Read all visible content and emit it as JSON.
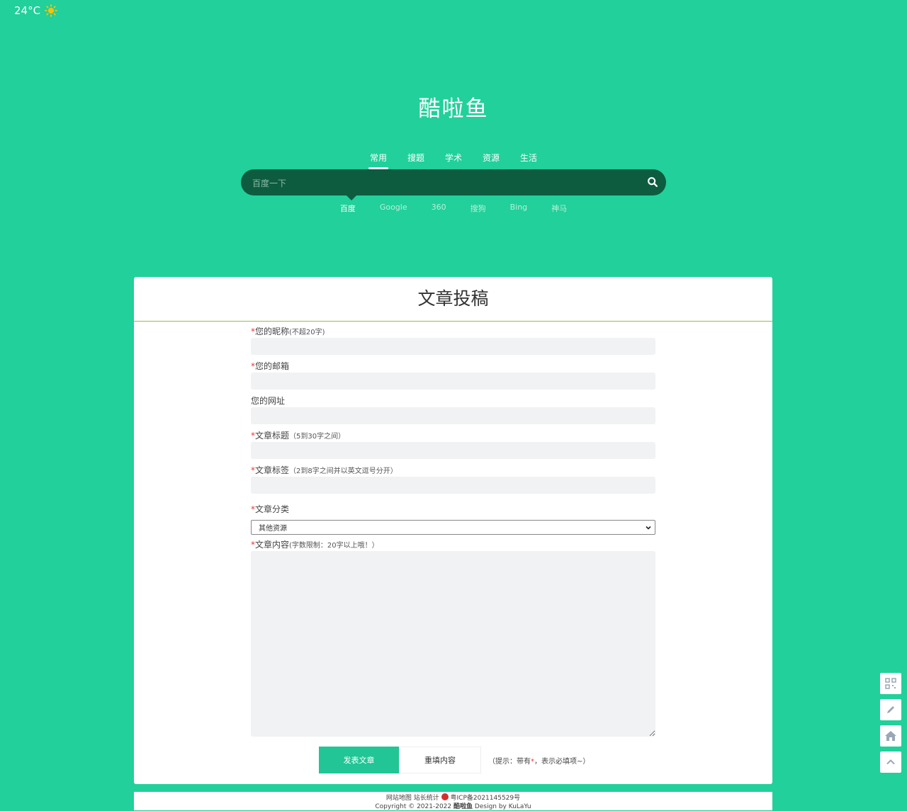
{
  "weather": {
    "temp": "24°C",
    "icon": "sun-icon"
  },
  "site": {
    "title": "酷啦鱼"
  },
  "tabs": [
    "常用",
    "搜题",
    "学术",
    "资源",
    "生活"
  ],
  "active_tab": "常用",
  "search": {
    "placeholder": "百度一下"
  },
  "engines": [
    "百度",
    "Google",
    "360",
    "搜狗",
    "Bing",
    "神马"
  ],
  "active_engine": "百度",
  "form": {
    "title": "文章投稿",
    "fields": {
      "nickname": {
        "label": "您的昵称",
        "hint": "(不超20字)",
        "required": true
      },
      "email": {
        "label": "您的邮箱",
        "hint": "",
        "required": true
      },
      "website": {
        "label": "您的网址",
        "hint": "",
        "required": false
      },
      "article_title": {
        "label": "文章标题",
        "hint": "（5到30字之间）",
        "required": true
      },
      "tags": {
        "label": "文章标签",
        "hint": "（2到8字之间并以英文逗号分开）",
        "required": true
      },
      "category": {
        "label": "文章分类",
        "hint": "",
        "required": true,
        "selected": "其他资源"
      },
      "content": {
        "label": "文章内容",
        "hint": "(字数限制：20字以上哦！）",
        "required": true
      }
    },
    "submit_label": "发表文章",
    "reset_label": "重填内容",
    "tip_prefix": "（提示：带有",
    "tip_star": "*",
    "tip_suffix": "，表示必填项~）"
  },
  "footer": {
    "sitemap": "网站地图",
    "stats": "站长统计",
    "icp": "粤ICP备2021145529号",
    "copyright": "Copyright © 2021-2022",
    "brand": "酷啦鱼",
    "design": "Design by KuLaYu"
  },
  "side_tools": [
    "qrcode-icon",
    "edit-icon",
    "home-icon",
    "back-to-top-icon"
  ],
  "colors": {
    "background": "#21d09a",
    "search_bar": "#0d5c40",
    "button": "#21c596",
    "required": "#e53935"
  }
}
